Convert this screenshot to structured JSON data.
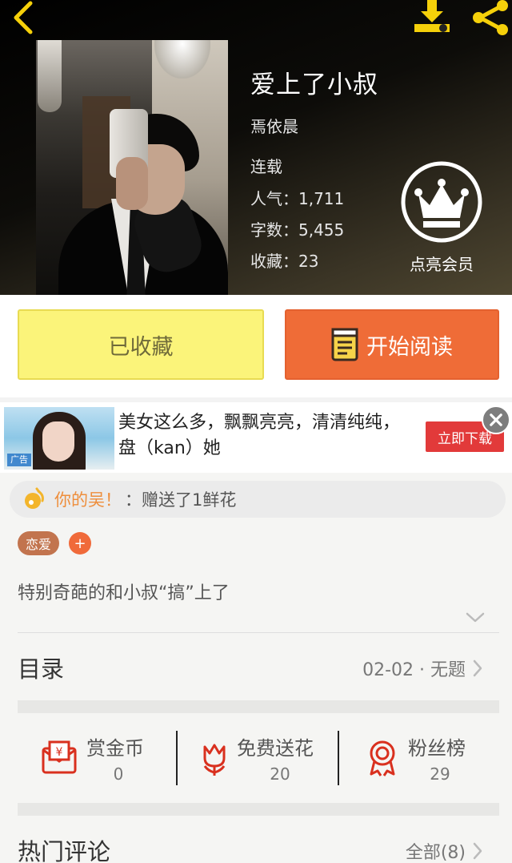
{
  "header": {
    "title": "爱上了小叔",
    "author": "焉依晨",
    "status": "连载",
    "popularity": "人气：1,711",
    "word_count": "字数：5,455",
    "favorites": "收藏：23",
    "vip_label": "点亮会员",
    "icons": [
      "back-icon",
      "download-icon",
      "share-icon",
      "crown-icon"
    ]
  },
  "actions": {
    "favorite_label": "已收藏",
    "read_label": "开始阅读"
  },
  "ad": {
    "text": "美女这么多，飘飘亮亮，清清纯纯，盘（kan）她",
    "image_tag": "广告",
    "button_label": "立即下载"
  },
  "gift": {
    "user": "你的吴！",
    "message": "：赠送了1鲜花"
  },
  "tags": {
    "genre": "恋爱",
    "add": "+"
  },
  "description": "特别奇葩的和小叔“搞”上了",
  "toc": {
    "label": "目录",
    "latest": "02-02 · 无题"
  },
  "stats": [
    {
      "label": "赏金币",
      "value": "0",
      "icon": "coin-envelope-icon"
    },
    {
      "label": "免费送花",
      "value": "20",
      "icon": "flower-icon"
    },
    {
      "label": "粉丝榜",
      "value": "29",
      "icon": "medal-icon"
    }
  ],
  "comments": {
    "label": "热门评论",
    "all": "全部(8)"
  },
  "colors": {
    "accent_yellow": "#f5d00a",
    "favorite_bg": "#fbf47a",
    "read_bg": "#ef6c37",
    "stat_icon": "#d9301e",
    "gift_user": "#ee8e3c"
  }
}
